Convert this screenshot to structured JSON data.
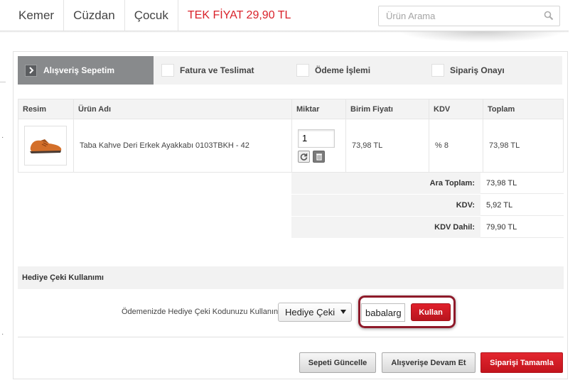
{
  "nav": {
    "items": [
      "Kemer",
      "Cüzdan",
      "Çocuk"
    ],
    "promo": "TEK FİYAT 29,90 TL",
    "search_placeholder": "Ürün Arama"
  },
  "steps": {
    "s1": "Alışveriş Sepetim",
    "s2": "Fatura ve Teslimat",
    "s3": "Ödeme İşlemi",
    "s4": "Sipariş Onayı"
  },
  "table": {
    "headers": [
      "Resim",
      "Ürün Adı",
      "Miktar",
      "Birim Fiyatı",
      "KDV",
      "Toplam"
    ],
    "row": {
      "product": "Taba Kahve Deri Erkek Ayakkabı 0103TBKH - 42",
      "qty": "1",
      "unit_price": "73,98 TL",
      "kdv": "% 8",
      "total": "73,98 TL"
    }
  },
  "totals": {
    "subtotal_label": "Ara Toplam:",
    "subtotal": "73,98 TL",
    "kdv_label": "KDV:",
    "kdv": "5,92 TL",
    "grand_label": "KDV Dahil:",
    "grand": "79,90 TL"
  },
  "gift": {
    "heading": "Hediye Çeki Kullanımı",
    "prompt": "Ödemenizde Hediye Çeki Kodunuzu Kullanın:",
    "select_value": "Hediye Çeki",
    "code_value": "babalarg",
    "use_label": "Kullan"
  },
  "actions": {
    "update": "Sepeti Güncelle",
    "continue": "Alışverişe Devam Et",
    "complete": "Siparişi Tamamla"
  },
  "colors": {
    "accent_red": "#d9222a",
    "step_active": "#888a8c",
    "highlight": "#8e1a2a"
  }
}
